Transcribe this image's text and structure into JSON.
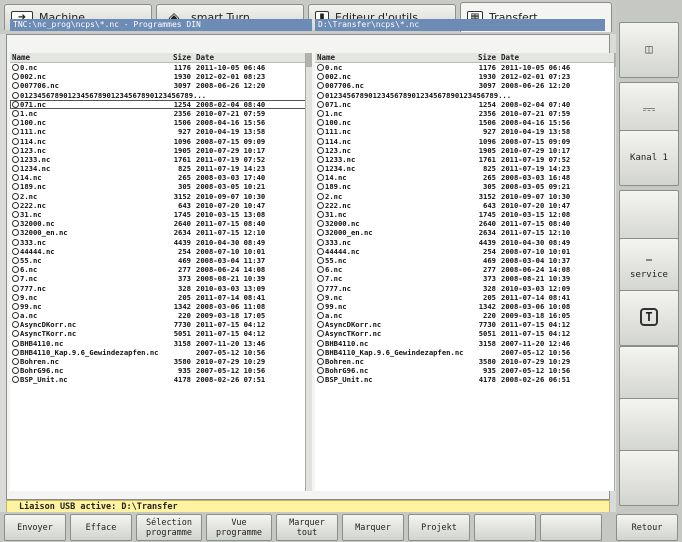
{
  "tabs": [
    {
      "label": "Machine",
      "icon": "arrow-right-icon"
    },
    {
      "label": "smart.Turn",
      "icon": "diamond-arrow-icon"
    },
    {
      "label": "Editeur d'outils",
      "icon": "tool-editor-icon"
    },
    {
      "label": "Transfert",
      "icon": "transfer-icon"
    }
  ],
  "left_pane": {
    "path": "TNC:\\nc_prog\\ncps\\*.nc - Programmes DIN",
    "headers": {
      "name": "Name",
      "size": "Size",
      "date": "Date"
    },
    "files": [
      {
        "name": "0.nc",
        "size": "1176",
        "date": "2011-10-05 06:46"
      },
      {
        "name": "002.nc",
        "size": "1930",
        "date": "2012-02-01 08:23"
      },
      {
        "name": "007706.nc",
        "size": "3097",
        "date": "2008-06-26 12:20"
      },
      {
        "name": "0123456789012345678901234567890123456789...",
        "size": "",
        "date": ""
      },
      {
        "name": "071.nc",
        "size": "1254",
        "date": "2008-02-04 08:40"
      },
      {
        "name": "1.nc",
        "size": "2356",
        "date": "2010-07-21 07:59"
      },
      {
        "name": "100.nc",
        "size": "1506",
        "date": "2008-04-16 15:56"
      },
      {
        "name": "111.nc",
        "size": "927",
        "date": "2010-04-19 13:58"
      },
      {
        "name": "114.nc",
        "size": "1096",
        "date": "2008-07-15 09:09"
      },
      {
        "name": "123.nc",
        "size": "1905",
        "date": "2010-07-29 10:17"
      },
      {
        "name": "1233.nc",
        "size": "1761",
        "date": "2011-07-19 07:52"
      },
      {
        "name": "1234.nc",
        "size": "825",
        "date": "2011-07-19 14:23"
      },
      {
        "name": "14.nc",
        "size": "265",
        "date": "2008-03-03 17:40"
      },
      {
        "name": "189.nc",
        "size": "305",
        "date": "2008-03-05 10:21"
      },
      {
        "name": "2.nc",
        "size": "3152",
        "date": "2010-09-07 10:30"
      },
      {
        "name": "222.nc",
        "size": "643",
        "date": "2010-07-20 10:47"
      },
      {
        "name": "31.nc",
        "size": "1745",
        "date": "2010-03-15 13:08"
      },
      {
        "name": "32000.nc",
        "size": "2640",
        "date": "2011-07-15 08:40"
      },
      {
        "name": "32000_en.nc",
        "size": "2634",
        "date": "2011-07-15 12:10"
      },
      {
        "name": "333.nc",
        "size": "4439",
        "date": "2010-04-30 08:49"
      },
      {
        "name": "44444.nc",
        "size": "254",
        "date": "2008-07-10 10:01"
      },
      {
        "name": "55.nc",
        "size": "469",
        "date": "2008-03-04 11:37"
      },
      {
        "name": "6.nc",
        "size": "277",
        "date": "2008-06-24 14:08"
      },
      {
        "name": "7.nc",
        "size": "373",
        "date": "2008-08-21 10:39"
      },
      {
        "name": "777.nc",
        "size": "328",
        "date": "2010-03-03 13:09"
      },
      {
        "name": "9.nc",
        "size": "205",
        "date": "2011-07-14 08:41"
      },
      {
        "name": "99.nc",
        "size": "1342",
        "date": "2008-03-06 11:08"
      },
      {
        "name": "a.nc",
        "size": "220",
        "date": "2009-03-18 17:05"
      },
      {
        "name": "AsyncDKorr.nc",
        "size": "7730",
        "date": "2011-07-15 04:12"
      },
      {
        "name": "AsyncTKorr.nc",
        "size": "5051",
        "date": "2011-07-15 04:12"
      },
      {
        "name": "BHB4110.nc",
        "size": "3158",
        "date": "2007-11-20 13:46"
      },
      {
        "name": "BHB4110_Kap.9.6_Gewindezapfen.nc",
        "size": "",
        "date": "2007-05-12 10:56"
      },
      {
        "name": "Bohren.nc",
        "size": "3580",
        "date": "2010-07-29 10:29"
      },
      {
        "name": "BohrG96.nc",
        "size": "935",
        "date": "2007-05-12 10:56"
      },
      {
        "name": "BSP_Unit.nc",
        "size": "4178",
        "date": "2008-02-26 07:51"
      }
    ]
  },
  "right_pane": {
    "path": "D:\\Transfer\\ncps\\*.nc",
    "headers": {
      "name": "Name",
      "size": "Size",
      "date": "Date"
    },
    "files": [
      {
        "name": "0.nc",
        "size": "1176",
        "date": "2011-10-05 06:46"
      },
      {
        "name": "002.nc",
        "size": "1930",
        "date": "2012-02-01 07:23"
      },
      {
        "name": "007706.nc",
        "size": "3097",
        "date": "2008-06-26 12:20"
      },
      {
        "name": "0123456789012345678901234567890123456789...",
        "size": "",
        "date": ""
      },
      {
        "name": "071.nc",
        "size": "1254",
        "date": "2008-02-04 07:40"
      },
      {
        "name": "1.nc",
        "size": "2356",
        "date": "2010-07-21 07:59"
      },
      {
        "name": "100.nc",
        "size": "1506",
        "date": "2008-04-16 15:56"
      },
      {
        "name": "111.nc",
        "size": "927",
        "date": "2010-04-19 13:58"
      },
      {
        "name": "114.nc",
        "size": "1096",
        "date": "2008-07-15 09:09"
      },
      {
        "name": "123.nc",
        "size": "1905",
        "date": "2010-07-29 10:17"
      },
      {
        "name": "1233.nc",
        "size": "1761",
        "date": "2011-07-19 07:52"
      },
      {
        "name": "1234.nc",
        "size": "825",
        "date": "2011-07-19 14:23"
      },
      {
        "name": "14.nc",
        "size": "265",
        "date": "2008-03-03 16:48"
      },
      {
        "name": "189.nc",
        "size": "305",
        "date": "2008-03-05 09:21"
      },
      {
        "name": "2.nc",
        "size": "3152",
        "date": "2010-09-07 10:30"
      },
      {
        "name": "222.nc",
        "size": "643",
        "date": "2010-07-20 10:47"
      },
      {
        "name": "31.nc",
        "size": "1745",
        "date": "2010-03-15 12:08"
      },
      {
        "name": "32000.nc",
        "size": "2640",
        "date": "2011-07-15 08:40"
      },
      {
        "name": "32000_en.nc",
        "size": "2634",
        "date": "2011-07-15 12:10"
      },
      {
        "name": "333.nc",
        "size": "4439",
        "date": "2010-04-30 08:49"
      },
      {
        "name": "44444.nc",
        "size": "254",
        "date": "2008-07-10 10:01"
      },
      {
        "name": "55.nc",
        "size": "469",
        "date": "2008-03-04 10:37"
      },
      {
        "name": "6.nc",
        "size": "277",
        "date": "2008-06-24 14:08"
      },
      {
        "name": "7.nc",
        "size": "373",
        "date": "2008-08-21 10:39"
      },
      {
        "name": "777.nc",
        "size": "328",
        "date": "2010-03-03 12:09"
      },
      {
        "name": "9.nc",
        "size": "205",
        "date": "2011-07-14 08:41"
      },
      {
        "name": "99.nc",
        "size": "1342",
        "date": "2008-03-06 10:08"
      },
      {
        "name": "a.nc",
        "size": "220",
        "date": "2009-03-18 16:05"
      },
      {
        "name": "AsyncDKorr.nc",
        "size": "7730",
        "date": "2011-07-15 04:12"
      },
      {
        "name": "AsyncTKorr.nc",
        "size": "5051",
        "date": "2011-07-15 04:12"
      },
      {
        "name": "BHB4110.nc",
        "size": "3158",
        "date": "2007-11-20 12:46"
      },
      {
        "name": "BHB4110_Kap.9.6_Gewindezapfen.nc",
        "size": "",
        "date": "2007-05-12 10:56"
      },
      {
        "name": "Bohren.nc",
        "size": "3580",
        "date": "2010-07-29 10:29"
      },
      {
        "name": "BohrG96.nc",
        "size": "935",
        "date": "2007-05-12 10:56"
      },
      {
        "name": "BSP_Unit.nc",
        "size": "4178",
        "date": "2008-02-26 06:51"
      }
    ]
  },
  "status": "Liaison USB active: D:\\Transfer",
  "side_keys": [
    "",
    "",
    "Kanal 1",
    "",
    "service",
    "",
    "",
    "",
    ""
  ],
  "bottom_keys": [
    "Envoyer",
    "Efface",
    "Sélection\nprogramme",
    "Vue\nprogramme",
    "Marquer\ntout",
    "Marquer",
    "Projekt",
    "",
    "",
    "Retour"
  ]
}
